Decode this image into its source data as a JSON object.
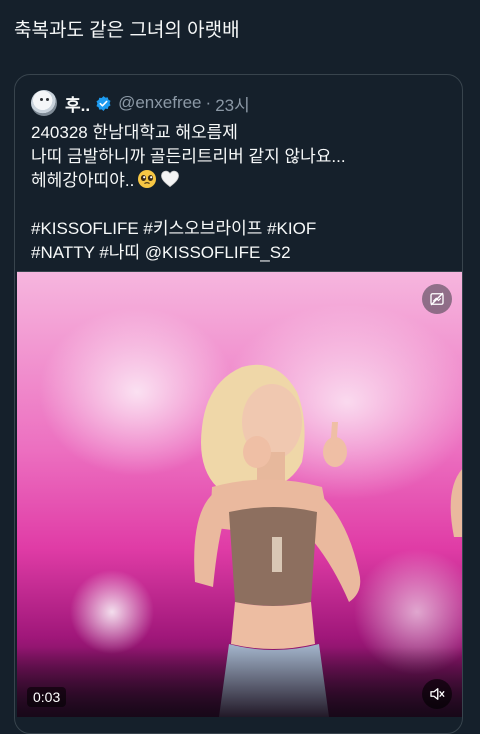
{
  "post": {
    "text": "축복과도 같은 그녀의 아랫배"
  },
  "quoted_tweet": {
    "display_name": "후..",
    "handle": "@enxefree",
    "separator": "·",
    "time": "23시",
    "lines": [
      "240328 한남대학교 해오름제",
      "나띠 금발하니까 골든리트리버 같지 않나요...",
      "헤헤강아띠야.."
    ],
    "hashtags_line1": "#KISSOFLIFE #키스오브라이프 #KIOF",
    "hashtags_line2": "#NATTY #나띠 @KISSOFLIFE_S2",
    "emojis": [
      "pleading-face",
      "white-heart"
    ]
  },
  "media": {
    "timestamp": "0:03",
    "top_icon": "data-saver-icon",
    "bottom_icon": "muted-speaker-icon"
  },
  "colors": {
    "background": "#15202b",
    "text": "#f7f9f9",
    "secondary": "#8b98a5",
    "border": "#38444d",
    "verified": "#1d9bf0"
  }
}
